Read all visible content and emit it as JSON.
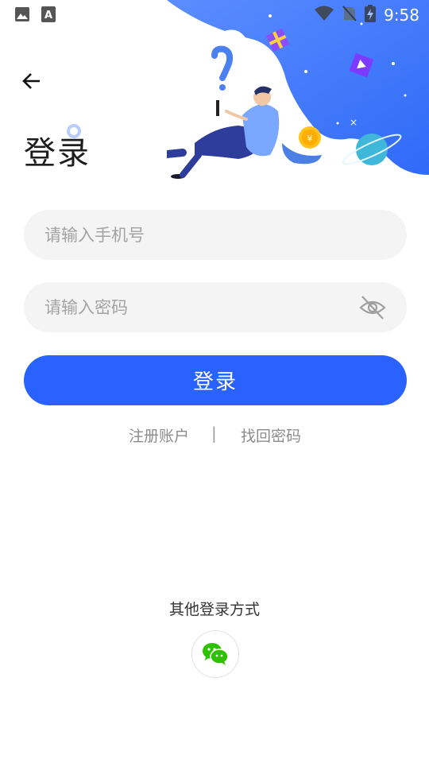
{
  "status_bar": {
    "time": "9:58",
    "icons": [
      "image-icon",
      "text-a-icon",
      "wifi-icon",
      "no-sim-icon",
      "battery-charging-icon"
    ]
  },
  "header": {
    "back_icon": "arrow-left-icon",
    "title": "登录"
  },
  "form": {
    "phone": {
      "value": "",
      "placeholder": "请输入手机号"
    },
    "password": {
      "value": "",
      "placeholder": "请输入密码",
      "toggle_icon": "eye-off-icon"
    },
    "submit_label": "登录"
  },
  "links": {
    "register": "注册账户",
    "separator": "|",
    "forgot": "找回密码"
  },
  "other_login": {
    "title": "其他登录方式",
    "wechat_icon": "wechat-icon"
  },
  "colors": {
    "primary": "#2962ff",
    "field_bg": "#f4f4f4",
    "placeholder": "#a3a3a3",
    "link": "#8c8c8c",
    "wechat_green": "#2dc100"
  }
}
